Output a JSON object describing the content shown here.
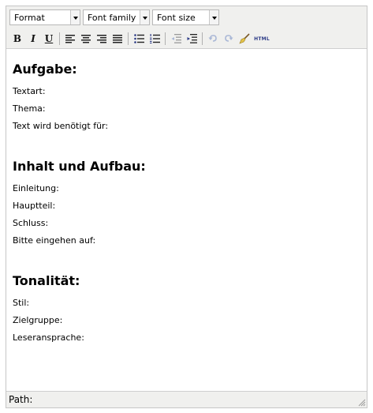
{
  "toolbar": {
    "format_label": "Format",
    "font_family_label": "Font family",
    "font_size_label": "Font size",
    "bold": "B",
    "italic": "I",
    "underline": "U",
    "html_label": "HTML"
  },
  "content": {
    "sections": [
      {
        "heading": "Aufgabe:",
        "lines": [
          "Textart:",
          "Thema:",
          "Text wird benötigt für:"
        ]
      },
      {
        "heading": "Inhalt und Aufbau:",
        "lines": [
          "Einleitung:",
          "Hauptteil:",
          "Schluss:",
          "Bitte eingehen auf:"
        ]
      },
      {
        "heading": "Tonalität:",
        "lines": [
          "Stil:",
          "Zielgruppe:",
          "Leseransprache:"
        ]
      }
    ]
  },
  "statusbar": {
    "path_label": "Path:"
  },
  "colors": {
    "toolbar_bg": "#f0f0ee",
    "border": "#c6c6c6",
    "icon_blue": "#2b3a86",
    "icon_disabled": "#a9b7d6"
  }
}
